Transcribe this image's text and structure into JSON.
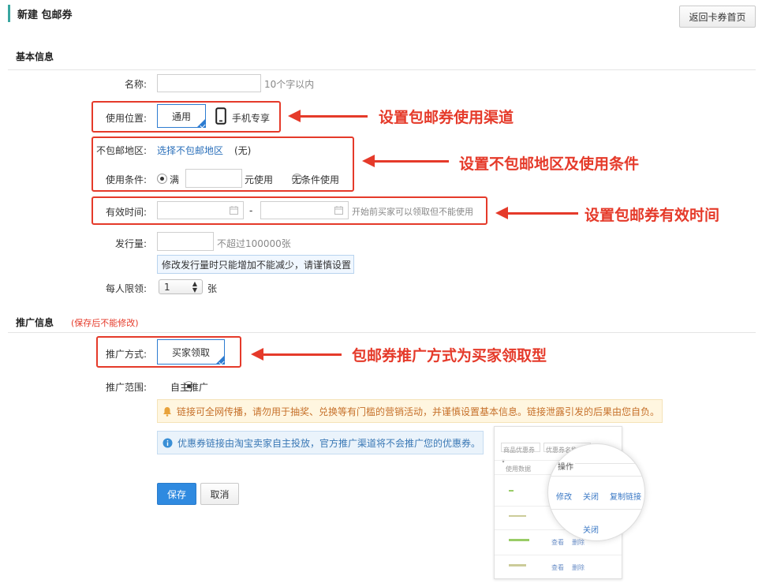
{
  "header": {
    "title": "新建 包邮券",
    "back_button": "返回卡券首页"
  },
  "basic": {
    "section_title": "基本信息",
    "name": {
      "label": "名称:",
      "value": "",
      "hint": "10个字以内"
    },
    "location": {
      "label": "使用位置:",
      "option_general": "通用",
      "option_mobile": "手机专享"
    },
    "region": {
      "label": "不包邮地区:",
      "link": "选择不包邮地区",
      "value": "(无)"
    },
    "condition": {
      "label": "使用条件:",
      "option_full": "满",
      "amount": "",
      "suffix": "元使用",
      "option_none": "无条件使用"
    },
    "validity": {
      "label": "有效时间:",
      "separator": "-",
      "hint": "开始前买家可以领取但不能使用"
    },
    "quantity": {
      "label": "发行量:",
      "hint": "不超过100000张",
      "tip": "修改发行量时只能增加不能减少，请谨慎设置"
    },
    "limit": {
      "label": "每人限领:",
      "selected": "1",
      "unit": "张"
    }
  },
  "promo": {
    "section_title": "推广信息",
    "section_note": "(保存后不能修改)",
    "method": {
      "label": "推广方式:",
      "option": "买家领取"
    },
    "scope": {
      "label": "推广范围:",
      "option": "自主推广"
    },
    "warning": "链接可全网传播，请勿用于抽奖、兑换等有门槛的营销活动，并谨慎设置基本信息。链接泄露引发的后果由您自负。",
    "info": "优惠券链接由淘宝卖家自主投放，官方推广渠道将不会推广您的优惠券。"
  },
  "actions": {
    "save": "保存",
    "cancel": "取消"
  },
  "annotations": {
    "a1": "设置包邮券使用渠道",
    "a2": "设置不包邮地区及使用条件",
    "a3": "设置包邮券有效时间",
    "a4": "包邮券推广方式为买家领取型"
  },
  "preview": {
    "dropdown": "商品优惠券 ▾",
    "search": "优惠券名称",
    "col1": "使用数据",
    "col2": "操作",
    "actions": [
      "修改",
      "关闭",
      "复制链接"
    ],
    "row_actions": [
      "查看",
      "删除"
    ]
  },
  "colors": {
    "accent": "#2f8ae0",
    "annotation": "#e53a2a",
    "title_bar": "#3aa6a0"
  }
}
